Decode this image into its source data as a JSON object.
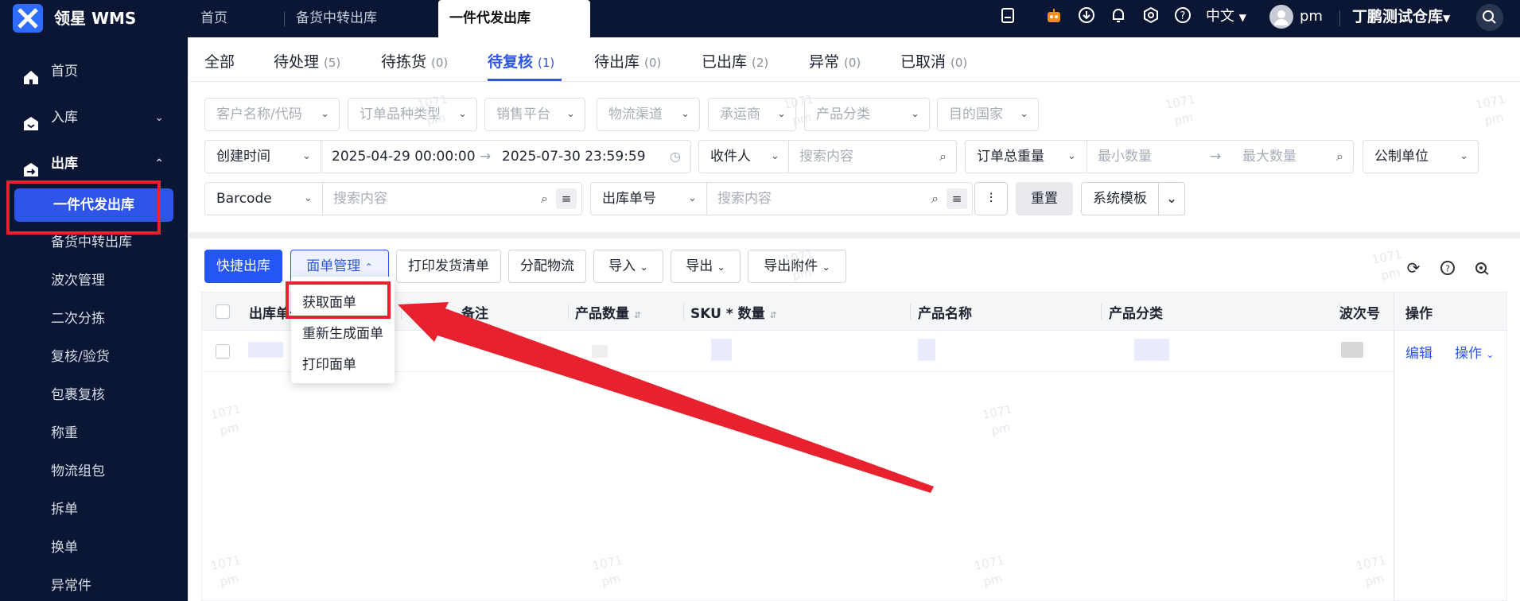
{
  "app": {
    "name": "领星 WMS"
  },
  "tabs": [
    {
      "label": "首页"
    },
    {
      "label": "备货中转出库"
    },
    {
      "label": "一件代发出库",
      "active": true
    }
  ],
  "topbar": {
    "language": "中文",
    "user": "pm",
    "warehouse": "丁鹏测试仓库",
    "icons": [
      "clipboard-icon",
      "robot-icon",
      "download-icon",
      "bell-icon",
      "settings-icon",
      "help-icon",
      "search-icon"
    ]
  },
  "sidebar": {
    "items": [
      {
        "label": "首页",
        "icon": "home-icon"
      },
      {
        "label": "入库",
        "icon": "inbound-icon",
        "chevron": "down"
      },
      {
        "label": "出库",
        "icon": "outbound-icon",
        "chevron": "up"
      }
    ],
    "sub_items": [
      {
        "label": "一件代发出库",
        "active": true
      },
      {
        "label": "备货中转出库"
      },
      {
        "label": "波次管理"
      },
      {
        "label": "二次分拣"
      },
      {
        "label": "复核/验货"
      },
      {
        "label": "包裹复核"
      },
      {
        "label": "称重"
      },
      {
        "label": "物流组包"
      },
      {
        "label": "拆单"
      },
      {
        "label": "换单"
      },
      {
        "label": "异常件"
      }
    ]
  },
  "status_tabs": [
    {
      "label": "全部",
      "count": ""
    },
    {
      "label": "待处理",
      "count": "(5)"
    },
    {
      "label": "待拣货",
      "count": "(0)"
    },
    {
      "label": "待复核",
      "count": "(1)",
      "active": true
    },
    {
      "label": "待出库",
      "count": "(0)"
    },
    {
      "label": "已出库",
      "count": "(2)"
    },
    {
      "label": "异常",
      "count": "(0)"
    },
    {
      "label": "已取消",
      "count": "(0)"
    }
  ],
  "filters": {
    "row1": [
      "客户名称/代码",
      "订单品种类型",
      "销售平台",
      "物流渠道",
      "承运商",
      "产品分类",
      "目的国家"
    ],
    "date_type": "创建时间",
    "date_start": "2025-04-29 00:00:00",
    "date_end": "2025-07-30 23:59:59",
    "recipient_type": "收件人",
    "search_placeholder": "搜索内容",
    "weight_type": "订单总重量",
    "min_placeholder": "最小数量",
    "max_placeholder": "最大数量",
    "unit": "公制单位",
    "barcode_type": "Barcode",
    "order_no_type": "出库单号",
    "reset": "重置",
    "template": "系统模板"
  },
  "toolbar": {
    "quick_out": "快捷出库",
    "label_mgmt": "面单管理",
    "print_list": "打印发货清单",
    "assign_logistics": "分配物流",
    "import": "导入",
    "export": "导出",
    "export_attach": "导出附件"
  },
  "dropdown": {
    "items": [
      "获取面单",
      "重新生成面单",
      "打印面单"
    ]
  },
  "table": {
    "columns": [
      "出库单号",
      "备注",
      "产品数量",
      "SKU * 数量",
      "产品名称",
      "产品分类",
      "波次号",
      "操作"
    ],
    "row_actions": {
      "edit": "编辑",
      "more": "操作"
    }
  },
  "watermark": {
    "line1": "1071",
    "line2": "pm"
  }
}
